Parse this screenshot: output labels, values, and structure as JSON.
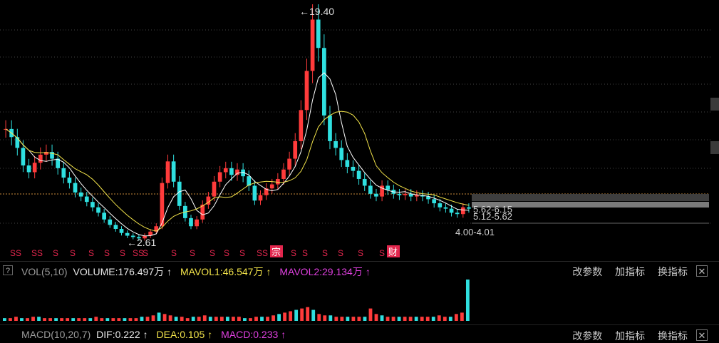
{
  "chart_data": {
    "type": "candlestick",
    "annotations": {
      "high_label": "←19.40",
      "low_label": "←2.61"
    },
    "price_zones": [
      {
        "label": "5.62-6.15"
      },
      {
        "label": "5.12-5.62"
      },
      {
        "label": "4.00-4.01"
      }
    ],
    "event_markers": [
      "S",
      "S",
      "S",
      "S",
      "S",
      "S",
      "S",
      "S",
      "S",
      "S",
      "S",
      "S",
      "S",
      "S",
      "S",
      "S",
      "S",
      "S",
      "S",
      "宗",
      "S",
      "S",
      "S",
      "S",
      "S",
      "S",
      "财"
    ],
    "close_series": [
      10.8,
      10.2,
      9.4,
      8.1,
      7.6,
      8.3,
      8.9,
      9.1,
      8.6,
      7.9,
      7.2,
      6.8,
      6.1,
      5.8,
      5.4,
      5.0,
      4.6,
      4.1,
      3.7,
      3.4,
      3.1,
      2.9,
      2.8,
      2.7,
      2.9,
      3.2,
      3.6,
      6.8,
      8.4,
      6.9,
      5.1,
      4.2,
      3.6,
      4.1,
      5.2,
      5.8,
      6.9,
      7.6,
      7.9,
      7.4,
      7.8,
      7.3,
      6.6,
      5.5,
      5.9,
      6.4,
      6.7,
      7.1,
      7.8,
      8.6,
      9.9,
      12.2,
      15.1,
      18.9,
      16.8,
      11.8,
      9.9,
      9.4,
      8.5,
      8.0,
      7.7,
      7.1,
      6.6,
      6.0,
      5.8,
      6.6,
      6.3,
      6.0,
      5.9,
      6.0,
      5.8,
      5.9,
      5.8,
      5.6,
      5.3,
      5.0,
      4.9,
      4.6,
      4.5,
      5.0,
      4.9
    ],
    "volume_series": [
      2,
      2,
      3,
      2,
      2,
      3,
      3,
      2,
      2,
      2,
      2,
      2,
      2,
      2,
      2,
      2,
      3,
      2,
      2,
      2,
      2,
      2,
      2,
      2,
      3,
      3,
      4,
      6,
      5,
      4,
      3,
      3,
      2,
      3,
      3,
      4,
      3,
      3,
      3,
      3,
      3,
      3,
      2,
      2,
      3,
      3,
      3,
      4,
      5,
      6,
      7,
      8,
      9,
      10,
      8,
      5,
      4,
      4,
      3,
      3,
      3,
      3,
      3,
      3,
      9,
      5,
      4,
      3,
      3,
      3,
      3,
      3,
      3,
      3,
      3,
      3,
      4,
      3,
      3,
      5,
      6,
      30
    ]
  },
  "volume_panel": {
    "help": "?",
    "name": "VOL(5,10)",
    "volume": "VOLUME:176.497万",
    "arrow": "↑",
    "mavol1": "MAVOL1:46.547万",
    "mavol2": "MAVOL2:29.134万",
    "actions": [
      "改参数",
      "加指标",
      "换指标"
    ],
    "close": "✕",
    "colors": {
      "volume": "#e8e8e8",
      "mavol1": "#f2e34a",
      "mavol2": "#e040e0"
    }
  },
  "macd_panel": {
    "name": "MACD(10,20,7)",
    "dif": "DIF:0.222",
    "dea": "DEA:0.105",
    "macd": "MACD:0.233",
    "arrow": "↑",
    "actions": [
      "改参数",
      "加指标",
      "换指标"
    ],
    "close": "✕"
  },
  "colors": {
    "up": "#ff3b3b",
    "down": "#2fe0e0",
    "ma_short": "#ffffff",
    "ma_long": "#f2e34a",
    "grid": "#444444",
    "ref": "#c98a3a",
    "marker": "#e2264d"
  }
}
